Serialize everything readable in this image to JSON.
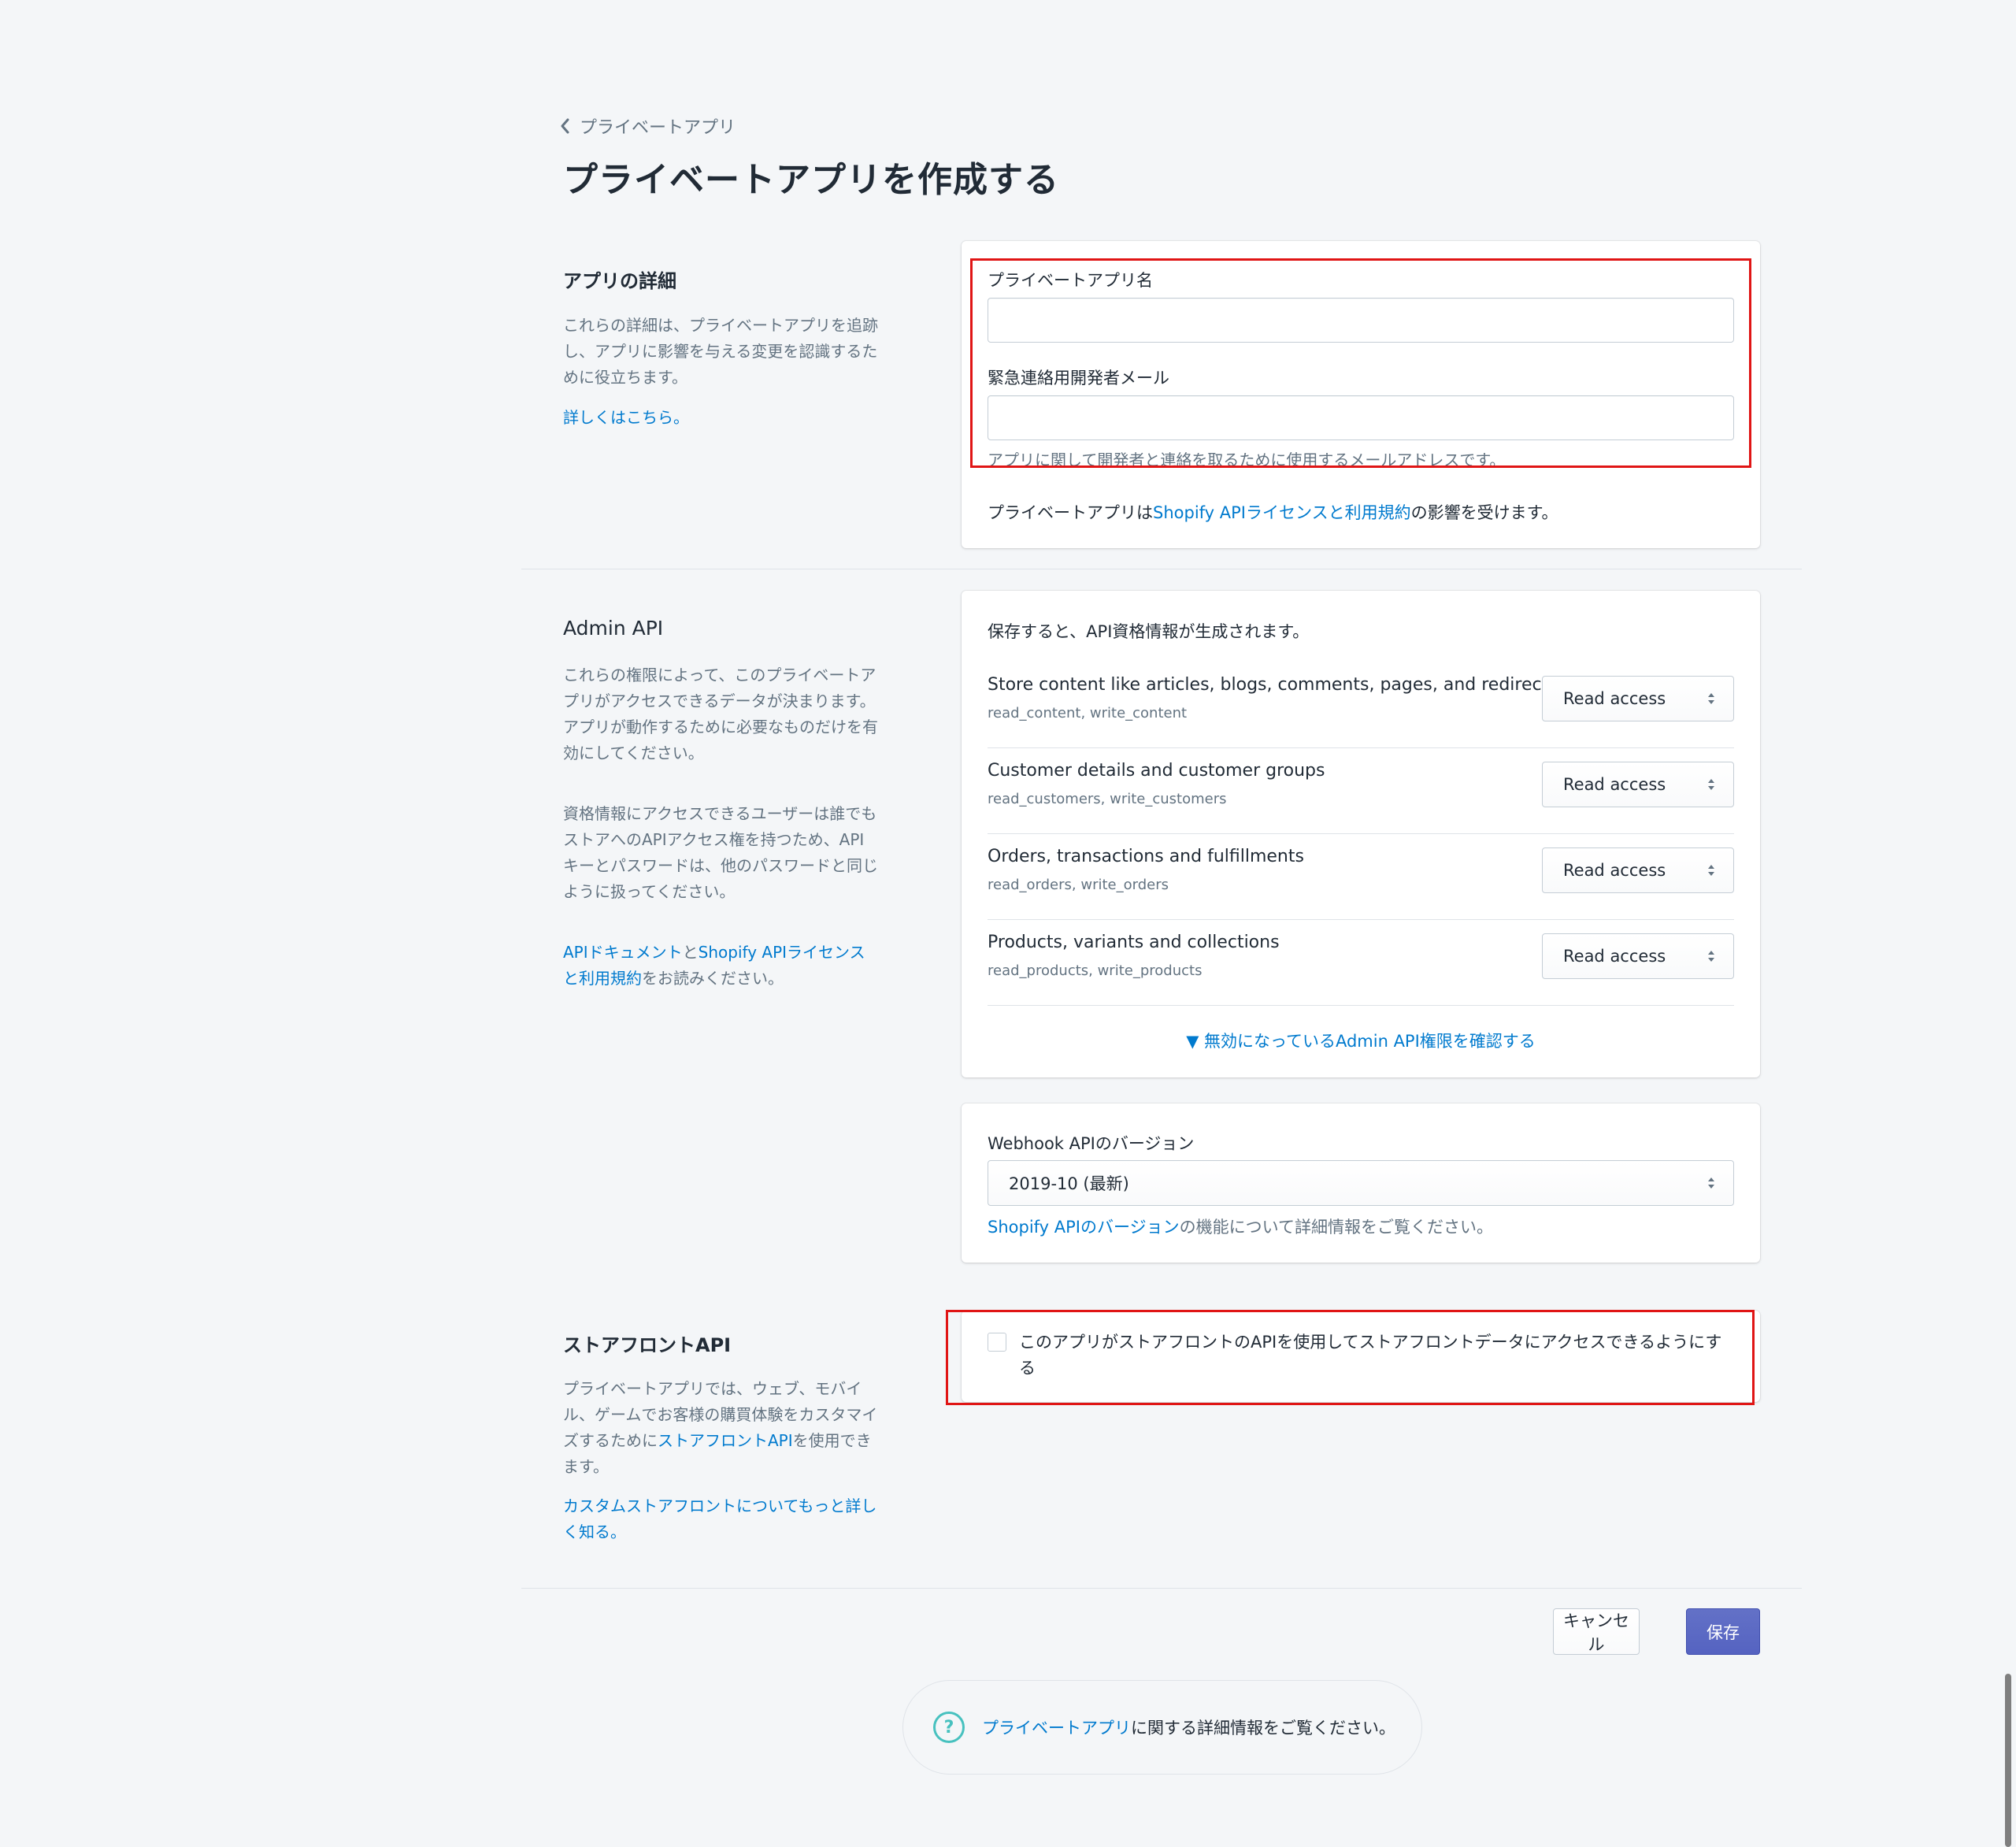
{
  "breadcrumb": {
    "label": "プライベートアプリ"
  },
  "page_title": "プライベートアプリを作成する",
  "app_details": {
    "title": "アプリの詳細",
    "description": "これらの詳細は、プライベートアプリを追跡し、アプリに影響を与える変更を認識するために役立ちます。",
    "learn_more": "詳しくはこちら。",
    "app_name_label": "プライベートアプリ名",
    "app_name_value": "",
    "email_label": "緊急連絡用開発者メール",
    "email_value": "",
    "email_help": "アプリに関して開発者と連絡を取るために使用するメールアドレスです。",
    "license_prefix": "プライベートアプリは",
    "license_link": "Shopify APIライセンスと利用規約",
    "license_suffix": "の影響を受けます。"
  },
  "admin_api": {
    "title": "Admin API",
    "description1": "これらの権限によって、このプライベートアプリがアクセスできるデータが決まります。アプリが動作するために必要なものだけを有効にしてください。",
    "description2": "資格情報にアクセスできるユーザーは誰でもストアへのAPIアクセス権を持つため、APIキーとパスワードは、他のパスワードと同じように扱ってください。",
    "docs_link": "APIドキュメント",
    "docs_and": "と",
    "license_link": "Shopify APIライセンスと利用規約",
    "docs_suffix": "をお読みください。",
    "intro": "保存すると、API資格情報が生成されます。",
    "permissions": [
      {
        "name": "Store content like articles, blogs, comments, pages, and redirects",
        "scopes": "read_content, write_content",
        "access": "Read access"
      },
      {
        "name": "Customer details and customer groups",
        "scopes": "read_customers, write_customers",
        "access": "Read access"
      },
      {
        "name": "Orders, transactions and fulfillments",
        "scopes": "read_orders, write_orders",
        "access": "Read access"
      },
      {
        "name": "Products, variants and collections",
        "scopes": "read_products, write_products",
        "access": "Read access"
      }
    ],
    "show_disabled": "▼ 無効になっているAdmin API権限を確認する",
    "webhook_label": "Webhook APIのバージョン",
    "webhook_value": "2019-10 (最新)",
    "webhook_help_link": "Shopify APIのバージョン",
    "webhook_help_suffix": "の機能について詳細情報をご覧ください。"
  },
  "storefront_api": {
    "title": "ストアフロントAPI",
    "desc_prefix": "プライベートアプリでは、ウェブ、モバイル、ゲームでお客様の購買体験をカスタマイズするために",
    "desc_link": "ストアフロントAPI",
    "desc_suffix": "を使用できます。",
    "learn_more": "カスタムストアフロントについてもっと詳しく知る。",
    "checkbox_label": "このアプリがストアフロントのAPIを使用してストアフロントデータにアクセスできるようにする",
    "checkbox_checked": false
  },
  "actions": {
    "cancel": "キャンセル",
    "save": "保存"
  },
  "footer": {
    "link": "プライベートアプリ",
    "suffix": "に関する詳細情報をご覧ください。",
    "icon": "question-circle-icon"
  },
  "colors": {
    "link": "#007ace",
    "primary": "#5c6ac4",
    "highlight": "#e01515",
    "info": "#47c1bf"
  }
}
